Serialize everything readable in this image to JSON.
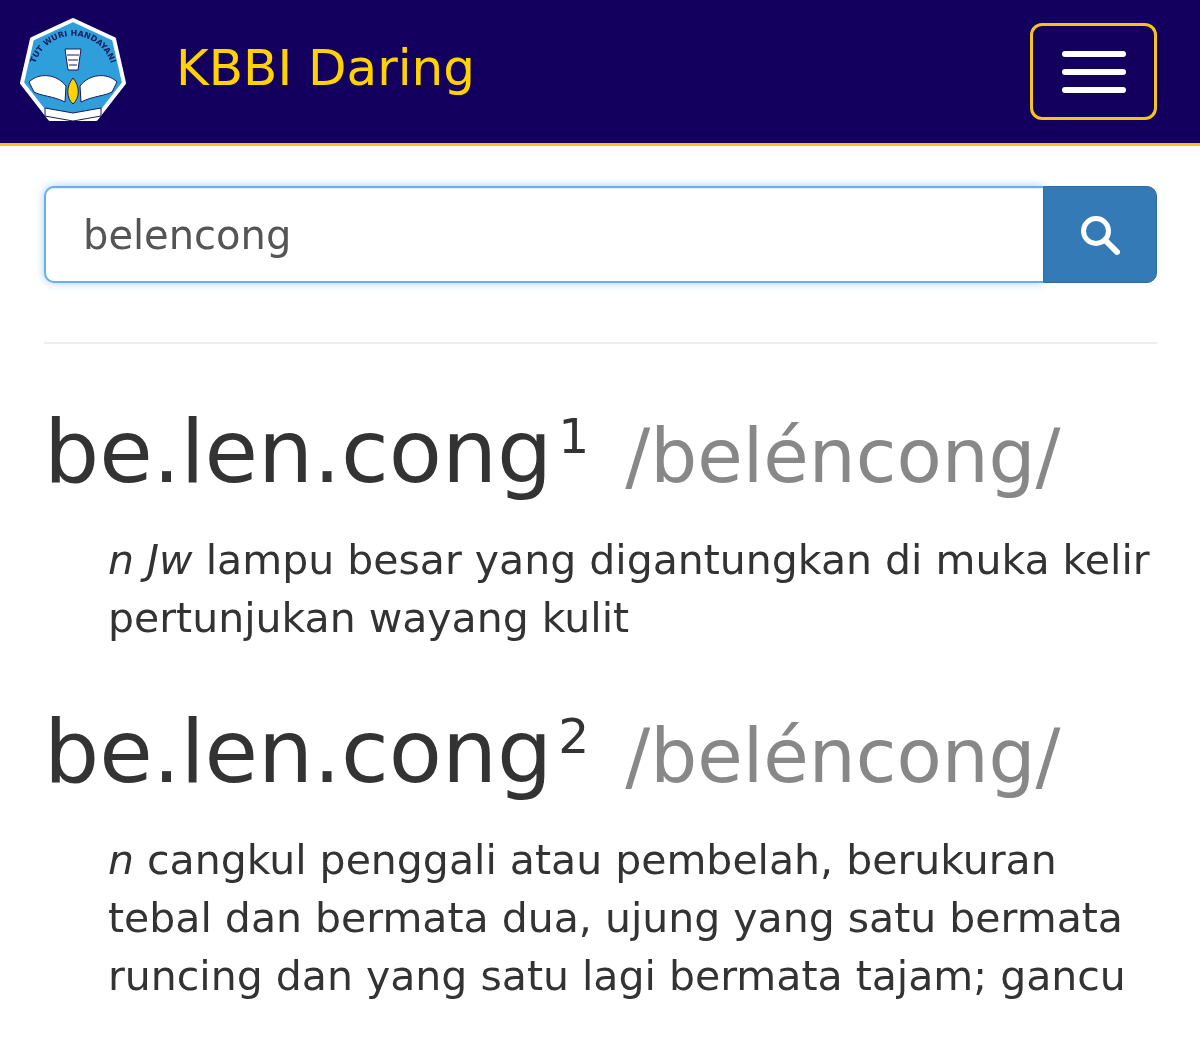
{
  "header": {
    "logo_text": "TUT WURI HANDAYANI",
    "title": "KBBI Daring"
  },
  "search": {
    "value": "belencong"
  },
  "entries": [
    {
      "headword": "be.len.cong$^{1}$",
      "pronunciation": "/beléncong/",
      "definition": "*n Jw* lampu besar yang digantungkan di muka kelir pertunjukan wayang kulit"
    },
    {
      "headword": "be.len.cong$^{2}$",
      "pronunciation": "/beléncong/",
      "definition": "*n* cangkul penggali atau pembelah, berukuran tebal dan bermata dua, ujung yang satu bermata runcing dan yang satu lagi bermata tajam; gancu"
    }
  ]
}
